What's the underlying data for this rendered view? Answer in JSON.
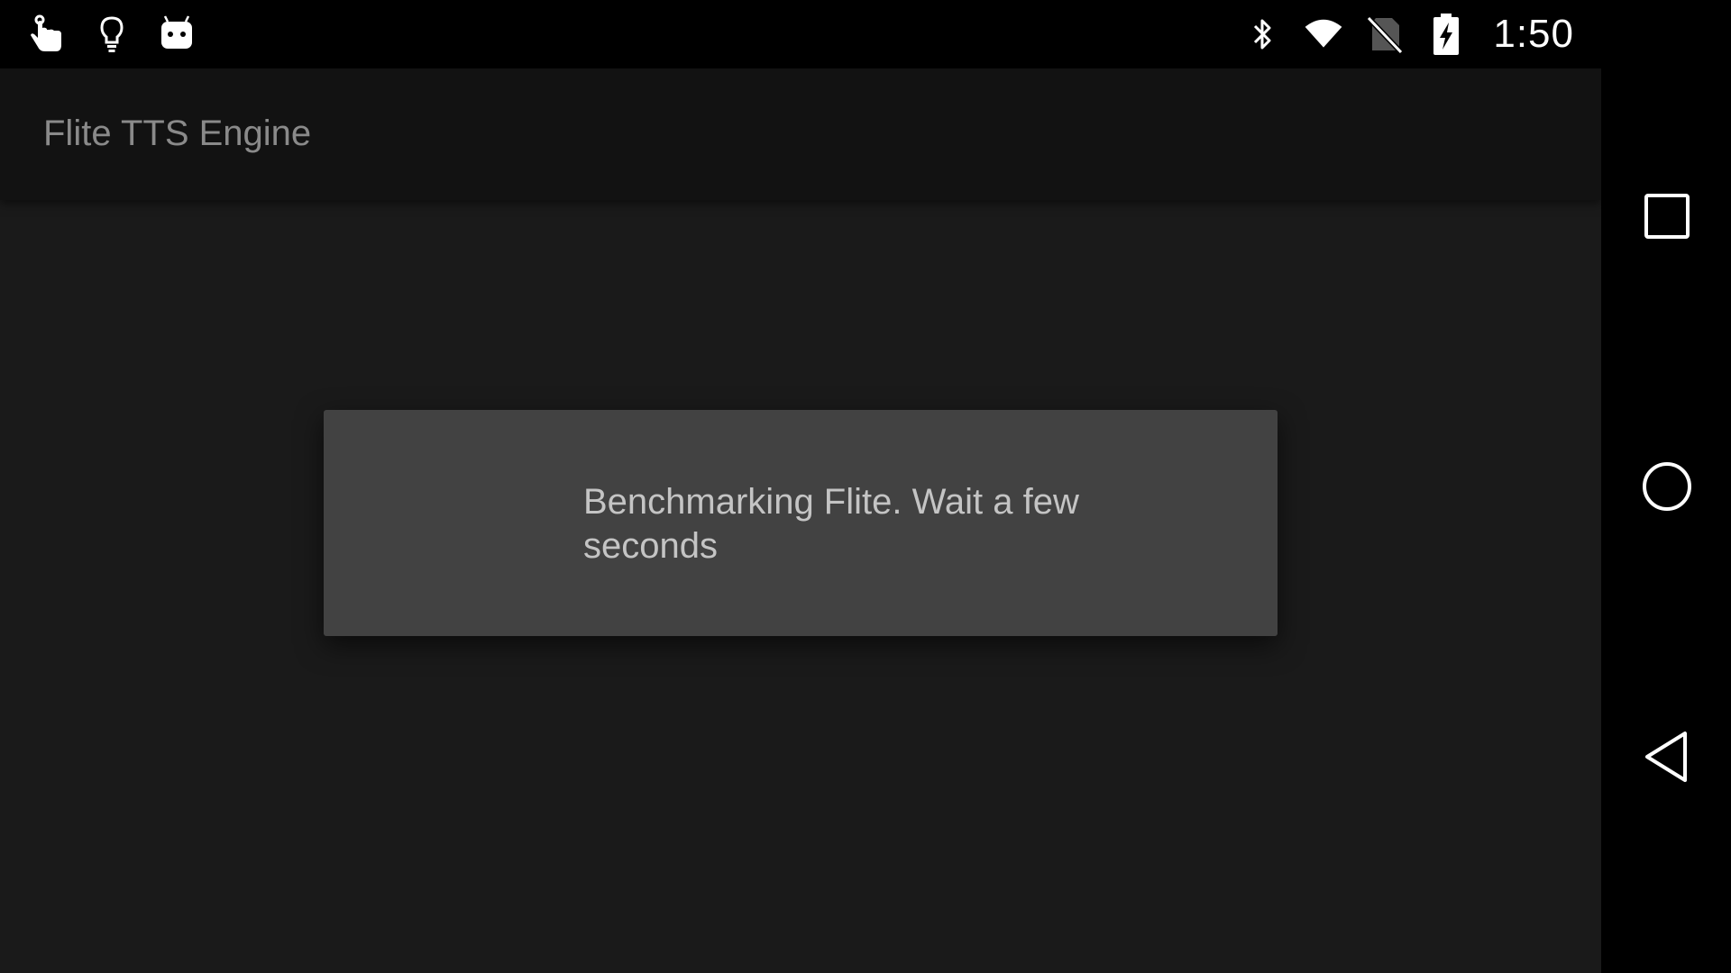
{
  "status_bar": {
    "left_icons": [
      "touch-hand-icon",
      "lightbulb-icon",
      "android-robot-icon"
    ],
    "right_icons": [
      "bluetooth-icon",
      "wifi-icon",
      "no-sim-icon",
      "battery-charging-icon"
    ],
    "time": "1:50"
  },
  "app_bar": {
    "title": "Flite TTS Engine"
  },
  "dialog": {
    "message": "Benchmarking Flite. Wait a few seconds"
  },
  "nav_bar": {
    "buttons": [
      "recents-icon",
      "home-icon",
      "back-icon"
    ]
  }
}
